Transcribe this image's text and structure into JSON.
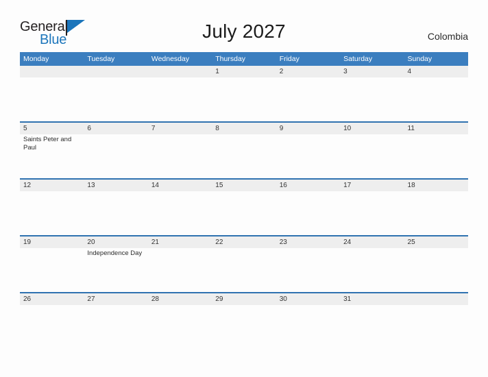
{
  "logo": {
    "word_one": "General",
    "word_two": "Blue",
    "flag_icon": "blue-triangle-flag-icon",
    "colors": {
      "dark": "#231f20",
      "blue": "#1b75bb"
    }
  },
  "header": {
    "title": "July 2027",
    "country": "Colombia"
  },
  "theme": {
    "header_blue": "#3b7ebf",
    "rule_blue": "#2f72b0",
    "band_gray": "#eeeeee",
    "page_bg": "#fdfdfd"
  },
  "weekdays": [
    "Monday",
    "Tuesday",
    "Wednesday",
    "Thursday",
    "Friday",
    "Saturday",
    "Sunday"
  ],
  "weeks": [
    {
      "days": [
        {
          "num": "",
          "events": []
        },
        {
          "num": "",
          "events": []
        },
        {
          "num": "",
          "events": []
        },
        {
          "num": "1",
          "events": []
        },
        {
          "num": "2",
          "events": []
        },
        {
          "num": "3",
          "events": []
        },
        {
          "num": "4",
          "events": []
        }
      ]
    },
    {
      "days": [
        {
          "num": "5",
          "events": [
            "Saints Peter and Paul"
          ]
        },
        {
          "num": "6",
          "events": []
        },
        {
          "num": "7",
          "events": []
        },
        {
          "num": "8",
          "events": []
        },
        {
          "num": "9",
          "events": []
        },
        {
          "num": "10",
          "events": []
        },
        {
          "num": "11",
          "events": []
        }
      ]
    },
    {
      "days": [
        {
          "num": "12",
          "events": []
        },
        {
          "num": "13",
          "events": []
        },
        {
          "num": "14",
          "events": []
        },
        {
          "num": "15",
          "events": []
        },
        {
          "num": "16",
          "events": []
        },
        {
          "num": "17",
          "events": []
        },
        {
          "num": "18",
          "events": []
        }
      ]
    },
    {
      "days": [
        {
          "num": "19",
          "events": []
        },
        {
          "num": "20",
          "events": [
            "Independence Day"
          ]
        },
        {
          "num": "21",
          "events": []
        },
        {
          "num": "22",
          "events": []
        },
        {
          "num": "23",
          "events": []
        },
        {
          "num": "24",
          "events": []
        },
        {
          "num": "25",
          "events": []
        }
      ]
    },
    {
      "days": [
        {
          "num": "26",
          "events": []
        },
        {
          "num": "27",
          "events": []
        },
        {
          "num": "28",
          "events": []
        },
        {
          "num": "29",
          "events": []
        },
        {
          "num": "30",
          "events": []
        },
        {
          "num": "31",
          "events": []
        },
        {
          "num": "",
          "events": []
        }
      ]
    }
  ]
}
